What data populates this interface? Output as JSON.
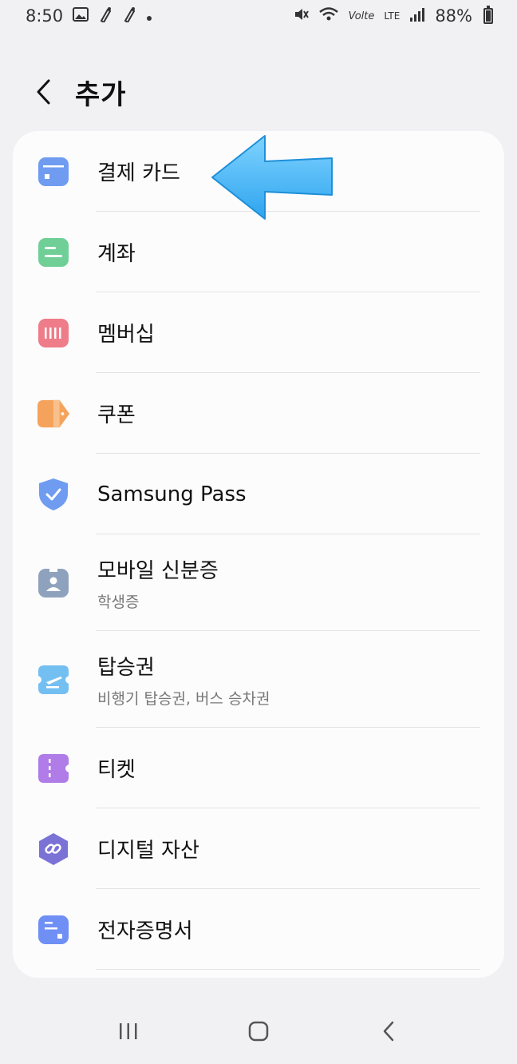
{
  "status_bar": {
    "time": "8:50",
    "battery": "88%",
    "network": "LTE",
    "volte": "Volte"
  },
  "header": {
    "title": "추가"
  },
  "items": [
    {
      "label": "결제 카드",
      "icon": "card-icon",
      "color": "#6f9cf0"
    },
    {
      "label": "계좌",
      "icon": "account-icon",
      "color": "#6fcf97"
    },
    {
      "label": "멤버십",
      "icon": "membership-icon",
      "color": "#ee7c89"
    },
    {
      "label": "쿠폰",
      "icon": "coupon-icon",
      "color": "#f5a35c"
    },
    {
      "label": "Samsung Pass",
      "icon": "shield-icon",
      "color": "#6f9cf0"
    },
    {
      "label": "모바일 신분증",
      "sub": "학생증",
      "icon": "id-card-icon",
      "color": "#8fa2bd"
    },
    {
      "label": "탑승권",
      "sub": "비행기 탑승권, 버스 승차권",
      "icon": "boarding-pass-icon",
      "color": "#74bff2"
    },
    {
      "label": "티켓",
      "icon": "ticket-icon",
      "color": "#b07ce8"
    },
    {
      "label": "디지털 자산",
      "icon": "digital-asset-icon",
      "color": "#7b72d6"
    },
    {
      "label": "전자증명서",
      "icon": "certificate-icon",
      "color": "#6f8ff5"
    }
  ],
  "annotation": {
    "arrow_color": "#3fb4f3"
  }
}
